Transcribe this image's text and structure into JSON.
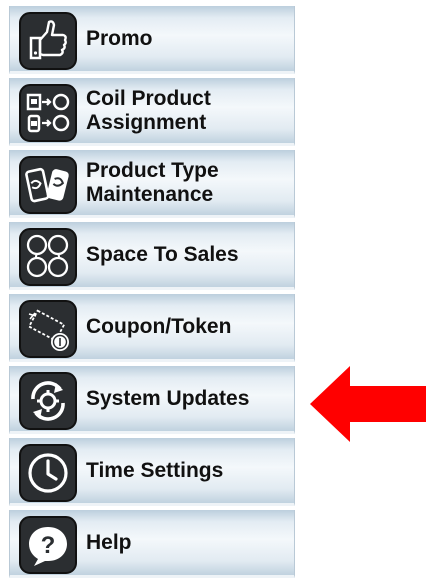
{
  "menu": {
    "items": [
      {
        "label": "Promo",
        "icon": "thumbs-up-icon"
      },
      {
        "label_line1": "Coil Product",
        "label_line2": "Assignment",
        "icon": "coil-assignment-icon"
      },
      {
        "label_line1": "Product Type",
        "label_line2": "Maintenance",
        "icon": "product-cans-icon"
      },
      {
        "label": "Space To Sales",
        "icon": "space-to-sales-icon"
      },
      {
        "label": "Coupon/Token",
        "icon": "coupon-token-icon"
      },
      {
        "label": "System Updates",
        "icon": "refresh-gear-icon"
      },
      {
        "label": "Time Settings",
        "icon": "clock-icon"
      },
      {
        "label": "Help",
        "icon": "help-question-icon"
      }
    ]
  },
  "annotation": {
    "arrow_color": "#ff0000",
    "arrow_icon": "red-arrow-left-icon"
  },
  "colors": {
    "icon_bg": "#2b2e31",
    "row_gradient_light": "#f4f8fb",
    "row_gradient_dark": "#bccfdd"
  }
}
